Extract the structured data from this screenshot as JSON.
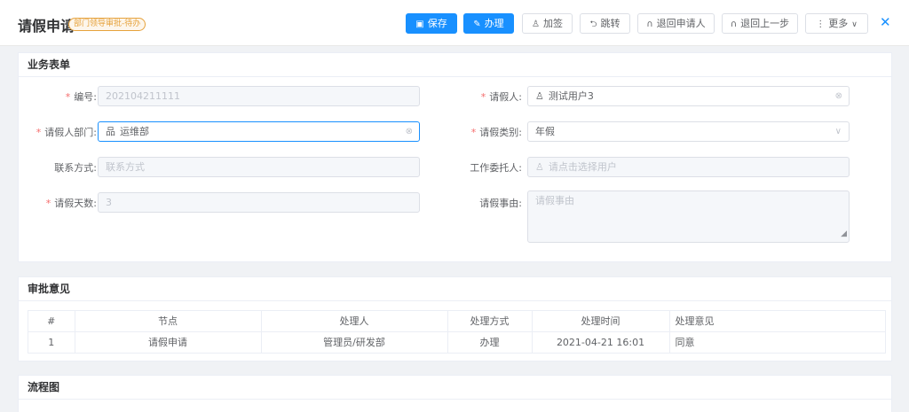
{
  "header": {
    "title": "请假申请",
    "badge": "部门领导审批-待办",
    "buttons": {
      "save": "保存",
      "handle": "办理",
      "add_sign": "加签",
      "jump": "跳转",
      "return_applicant": "退回申请人",
      "return_prev": "退回上一步",
      "more": "更多"
    }
  },
  "form": {
    "section_title": "业务表单",
    "number": {
      "label": "编号:",
      "value": "202104211111"
    },
    "applicant": {
      "label": "请假人:",
      "value": "测试用户3"
    },
    "dept": {
      "label": "请假人部门:",
      "value": "运维部"
    },
    "leave_type": {
      "label": "请假类别:",
      "value": "年假"
    },
    "contact": {
      "label": "联系方式:",
      "placeholder": "联系方式"
    },
    "delegate": {
      "label": "工作委托人:",
      "placeholder": "请点击选择用户"
    },
    "days": {
      "label": "请假天数:",
      "value": "3"
    },
    "reason": {
      "label": "请假事由:",
      "placeholder": "请假事由"
    }
  },
  "approval": {
    "section_title": "审批意见",
    "columns": [
      "#",
      "节点",
      "处理人",
      "处理方式",
      "处理时间",
      "处理意见"
    ],
    "rows": [
      {
        "index": "1",
        "node": "请假申请",
        "handler": "管理员/研发部",
        "method": "办理",
        "time": "2021-04-21 16:01",
        "opinion": "同意"
      }
    ]
  },
  "flow": {
    "section_title": "流程图"
  },
  "colors": {
    "primary": "#1890ff",
    "required": "#f56c6c",
    "badge": "#e6a23c"
  }
}
